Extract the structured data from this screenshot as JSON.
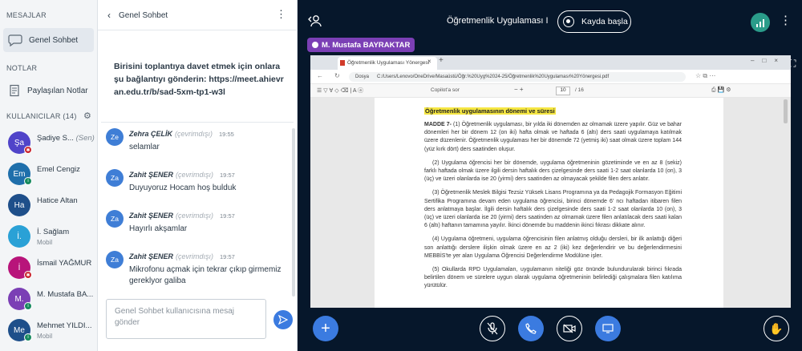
{
  "sidebar": {
    "messages_label": "MESAJLAR",
    "public_chat": "Genel Sohbet",
    "notes_label": "NOTLAR",
    "shared_notes": "Paylaşılan Notlar",
    "users_label": "KULLANICILAR (14)",
    "users": [
      {
        "initials": "Şa",
        "name": "Şadiye S...",
        "suffix": "(Sen)",
        "sub": "",
        "color": "#5044c9",
        "badge_color": "#c9232c",
        "badge": "✱"
      },
      {
        "initials": "Em",
        "name": "Emel Cengiz",
        "suffix": "",
        "sub": "",
        "color": "#1f6fab",
        "badge_color": "#178a5e",
        "badge": "i"
      },
      {
        "initials": "Ha",
        "name": "Hatice Altan",
        "suffix": "",
        "sub": "",
        "color": "#1e4f8a",
        "badge_color": "",
        "badge": ""
      },
      {
        "initials": "İ.",
        "name": "İ. Sağlam",
        "suffix": "",
        "sub": "Mobil",
        "color": "#2aa1d6",
        "badge_color": "",
        "badge": ""
      },
      {
        "initials": "İ",
        "name": "İsmail YAĞMUR",
        "suffix": "",
        "sub": "",
        "color": "#b8147a",
        "badge_color": "#c9232c",
        "badge": "✱"
      },
      {
        "initials": "M.",
        "name": "M. Mustafa BA...",
        "suffix": "",
        "sub": "",
        "color": "#7b3fb5",
        "badge_color": "#178a5e",
        "badge": "i"
      },
      {
        "initials": "Me",
        "name": "Mehmet YILDI...",
        "suffix": "",
        "sub": "Mobil",
        "color": "#1e4f8a",
        "badge_color": "#178a5e",
        "badge": "i"
      }
    ]
  },
  "chat": {
    "title": "Genel Sohbet",
    "welcome": "Birisini toplantıya davet etmek için onlara şu bağlantıyı gönderin: https://meet.ahievran.edu.tr/b/sad-5xm-tp1-w3l",
    "messages": [
      {
        "initials": "Ze",
        "name": "Zehra ÇELİK",
        "status": "(çevrimdışı)",
        "time": "19:55",
        "text": "selamlar"
      },
      {
        "initials": "Za",
        "name": "Zahit ŞENER",
        "status": "(çevrimdışı)",
        "time": "19:57",
        "text": "Duyuyoruz Hocam hoş bulduk"
      },
      {
        "initials": "Za",
        "name": "Zahit ŞENER",
        "status": "(çevrimdışı)",
        "time": "19:57",
        "text": "Hayırlı akşamlar"
      },
      {
        "initials": "Za",
        "name": "Zahit ŞENER",
        "status": "(çevrimdışı)",
        "time": "19:57",
        "text": "Mikrofonu açmak için tekrar çıkıp girmemiz gereklyor galiba"
      }
    ],
    "input_placeholder": "Genel Sohbet kullanıcısına mesaj gönder"
  },
  "meeting": {
    "title": "Öğretmenlik Uygulaması I",
    "record_label": "Kayda başla",
    "presenter": "M. Mustafa BAYRAKTAR"
  },
  "browser": {
    "tab_title": "Öğretmenlik Uygulaması Yönergesi",
    "file_label": "Dosya",
    "url": "C:/Users/Lenovo/OneDrive/Masaüstü/Öğr.%20Uyg%2024-25/Öğretmenlik%20Uygulaması%20Yönergesi.pdf",
    "page_current": "10",
    "page_total": "/ 16",
    "copilot_label": "Copilot'a sor"
  },
  "document": {
    "heading": "Öğretmenlik uygulamasının dönemi ve süresi",
    "article": "MADDE 7-",
    "paragraphs": [
      "(1) Öğretmenlik uygulaması, bir yılda iki dönemden az olmamak üzere yapılır. Güz ve bahar dönemleri her bir dönem 12 (on iki) hafta olmak ve haftada 6 (altı) ders saati uygulamaya katılmak üzere düzenlenir. Öğretmenlik uygulaması her bir dönemde 72 (yetmiş iki) saat olmak üzere toplam 144 (yüz kırk dört) ders saatinden oluşur.",
      "(2) Uygulama öğrencisi her bir dönemde, uygulama öğretmeninin gözetiminde ve en az 8 (sekiz) farklı haftada olmak üzere ilgili dersin haftalık ders çizelgesinde ders saati 1-2 saat olanlarda 10 (on), 3 (üç) ve üzeri olanlarda ise 20 (yirmi) ders saatinden az olmayacak şekilde filen ders anlatır.",
      "(3) Öğretmenlik Meslek Bilgisi Tezsiz Yüksek Lisans Programına ya da Pedagojik Formasyon Eğitimi Sertifika Programına devam eden uygulama öğrencisi, birinci dönemde 6' ncı haftadan itibaren filen ders anlatmaya başlar. İlgili dersin haftalık ders çizelgesinde ders saati 1-2 saat olanlarda 10 (on), 3 (üç) ve üzeri olanlarda ise 20 (yirmi) ders saatinden az olmamak üzere filen anlatılacak ders saati kalan 6 (altı) haftanın tamamına yayılır. İkinci dönemde bu maddenin ikinci fıkrası dikkate alınır.",
      "(4) Uygulama öğretmeni, uygulama öğrencisinin filen anlatmış olduğu dersleri, bir ilk anlattığı diğeri son anlattığı derslere ilişkin olmak üzere en az 2 (iki) kez değerlendirir ve bu değerlendirmesini MEBBİS'te yer alan Uygulama Öğrencisi Değerlendirme Modülüne işler.",
      "(5) Okullarda RPD Uygulamaları, uygulamanın niteliği göz önünde bulundurularak birinci fıkrada belirtilen dönem ve sürelere uygun olarak uygulama öğretmeninin belirlediği çalışmalara filen katılıma yürütülür."
    ]
  },
  "colors": {
    "accent": "#3b7be0",
    "main_bg": "#06172b",
    "highlight": "#f5e642"
  }
}
